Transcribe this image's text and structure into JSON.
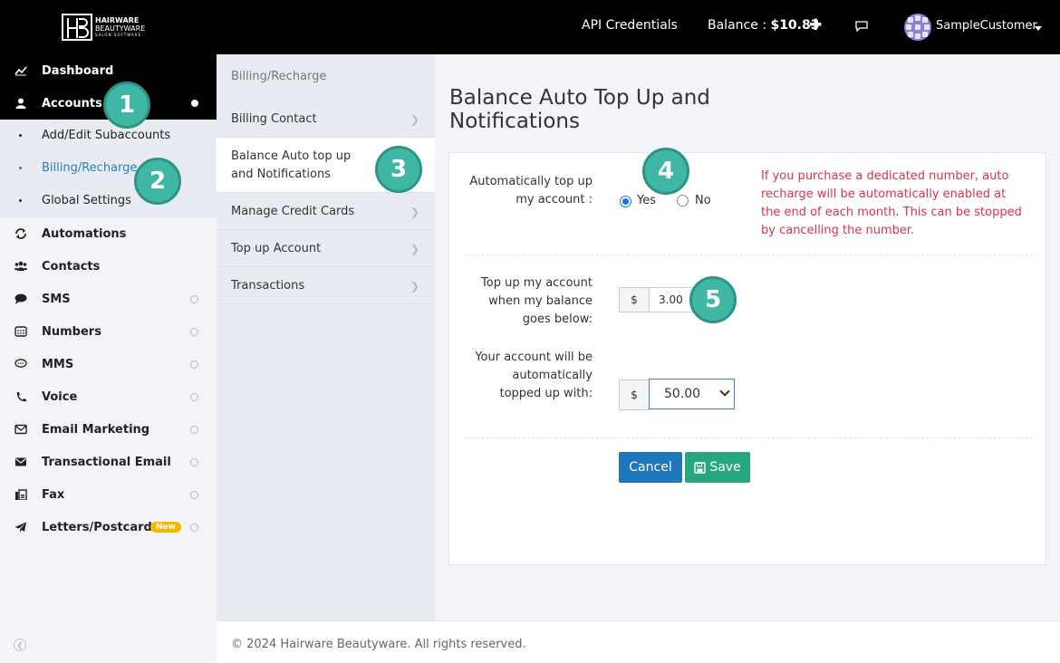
{
  "brand": {
    "line1": "HAIRWARE",
    "line2": "BEAUTYWARE",
    "line3": "SALON SOFTWARE"
  },
  "topbar": {
    "api_credentials": "API Credentials",
    "balance_label": "Balance : ",
    "balance_value": "$10.83",
    "add_funds_icon": "plus-icon",
    "chat_icon": "chat-icon",
    "username": "SampleCustomer"
  },
  "sidebar": {
    "items": [
      {
        "label": "Dashboard",
        "icon": "chart-line-icon"
      },
      {
        "label": "Accounts",
        "icon": "user-icon"
      },
      {
        "label": "Automations",
        "icon": "refresh-icon"
      },
      {
        "label": "Contacts",
        "icon": "users-icon"
      },
      {
        "label": "SMS",
        "icon": "comment-icon"
      },
      {
        "label": "Numbers",
        "icon": "phone-keypad-icon"
      },
      {
        "label": "MMS",
        "icon": "comment-dots-icon"
      },
      {
        "label": "Voice",
        "icon": "phone-icon"
      },
      {
        "label": "Email Marketing",
        "icon": "envelope-outline-icon"
      },
      {
        "label": "Transactional Email",
        "icon": "envelope-icon"
      },
      {
        "label": "Fax",
        "icon": "fax-icon"
      },
      {
        "label": "Letters/Postcards",
        "icon": "paper-plane-icon",
        "badge": "New"
      }
    ],
    "subitems": [
      {
        "label": "Add/Edit Subaccounts"
      },
      {
        "label": "Billing/Recharge"
      },
      {
        "label": "Global Settings"
      }
    ]
  },
  "steps": [
    "1",
    "2",
    "3",
    "4",
    "5"
  ],
  "subnav": {
    "heading": "Billing/Recharge",
    "items": [
      {
        "label": "Billing Contact"
      },
      {
        "label": "Balance Auto top up and Notifications"
      },
      {
        "label": "Manage Credit Cards"
      },
      {
        "label": "Top up Account"
      },
      {
        "label": "Transactions"
      }
    ]
  },
  "main": {
    "title": "Balance Auto Top Up and Notifications",
    "auto_topup_label": "Automatically top up my account :",
    "yes_label": "Yes",
    "no_label": "No",
    "auto_topup_value": "Yes",
    "note": "If you purchase a dedicated number, auto recharge will be automatically enabled at the end of each month. This can be stopped by cancelling the number.",
    "threshold_label": "Top up my account when my balance goes below:",
    "currency": "$",
    "threshold_value": "3.00",
    "amount_label": "Your account will be automatically topped up with:",
    "amount_value": "50.00",
    "cancel_label": "Cancel",
    "save_label": "Save"
  },
  "footer": {
    "text": "© 2024 Hairware Beautyware. All rights reserved."
  },
  "colors": {
    "accent": "#1f77c0",
    "save": "#27a67f",
    "note": "#d9334b",
    "step": "#3fb7a4"
  }
}
